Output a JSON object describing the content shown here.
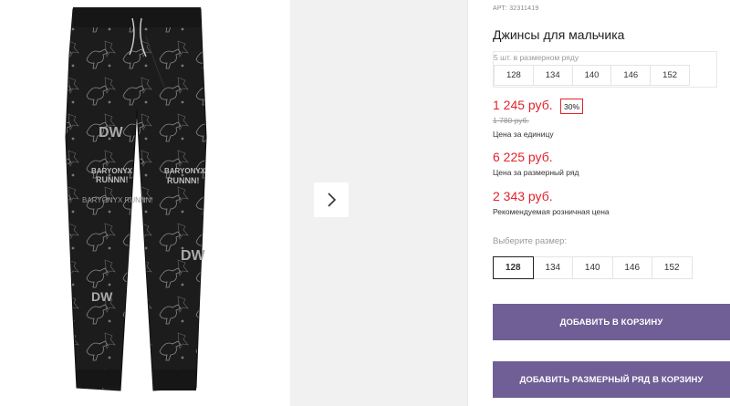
{
  "gallery": {
    "image_alt": "black jogger pants with dinosaur print",
    "print_texts": [
      "BARYONYX",
      "RUNNN!",
      "DW",
      "BARYONYX RUNNN!"
    ],
    "next_icon": "chevron-right-icon"
  },
  "product": {
    "article": "АРТ: 32311419",
    "title": "Джинсы для мальчика"
  },
  "size_range": {
    "caption": "5 шт. в размерном ряду",
    "sizes": [
      "128",
      "134",
      "140",
      "146",
      "152"
    ]
  },
  "price": {
    "current": "1 245 руб.",
    "discount": "30%",
    "old": "1 780 руб.",
    "unit_note": "Цена за единицу",
    "range_price": "6 225 руб.",
    "range_note": "Цена за размерный ряд",
    "retail_price": "2 343 руб.",
    "retail_note": "Рекомендуемая розничная цена"
  },
  "size_select": {
    "label": "Выберите размер:",
    "options": [
      "128",
      "134",
      "140",
      "146",
      "152"
    ],
    "selected": "128"
  },
  "actions": {
    "add_to_cart": "ДОБАВИТЬ В КОРЗИНУ",
    "add_range_to_cart": "ДОБАВИТЬ РАЗМЕРНЫЙ РЯД В КОРЗИНУ"
  },
  "colors": {
    "accent_purple": "#6f5f96",
    "price_red": "#e2232a"
  }
}
